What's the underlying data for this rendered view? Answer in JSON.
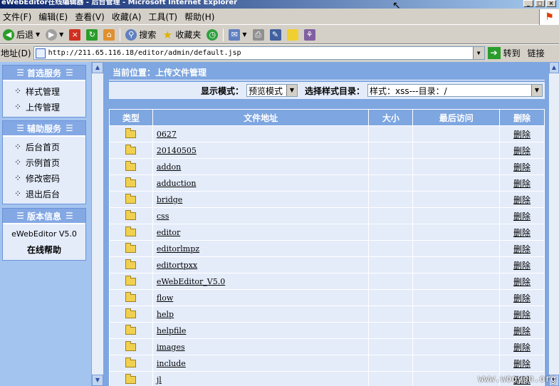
{
  "window": {
    "title": "eWebEditor在线编辑器 - 后台管理 - Microsoft Internet Explorer"
  },
  "menu": [
    "文件(F)",
    "编辑(E)",
    "查看(V)",
    "收藏(A)",
    "工具(T)",
    "帮助(H)"
  ],
  "toolbar": {
    "back": "后退",
    "search": "搜索",
    "favorites": "收藏夹"
  },
  "address": {
    "label": "地址(D)",
    "url": "http://211.65.116.18/editor/admin/default.jsp",
    "go": "转到",
    "links": "链接"
  },
  "sidebar": {
    "primary": {
      "title": "首选服务",
      "items": [
        "样式管理",
        "上传管理"
      ]
    },
    "aux": {
      "title": "辅助服务",
      "items": [
        "后台首页",
        "示例首页",
        "修改密码",
        "退出后台"
      ]
    },
    "version": {
      "title": "版本信息",
      "version": "eWebEditor V5.0",
      "help": "在线帮助"
    }
  },
  "main": {
    "breadcrumb": "当前位置：上传文件管理",
    "display_mode_label": "显示模式：",
    "display_mode_value": "预览模式",
    "dir_label": "选择样式目录：",
    "dir_value": "样式：xss---目录：/"
  },
  "table": {
    "headers": {
      "type": "类型",
      "path": "文件地址",
      "size": "大小",
      "last_access": "最后访问",
      "delete": "删除"
    },
    "delete_label": "删除",
    "rows": [
      "0627",
      "20140505",
      "addon",
      "adduction",
      "bridge",
      "css",
      "editor",
      "editorlmpz",
      "editortpxx",
      "eWebEditor_V5.0",
      "flow",
      "help",
      "helpfile",
      "images",
      "include",
      "jl"
    ]
  },
  "watermark": "www.wooyun.org"
}
